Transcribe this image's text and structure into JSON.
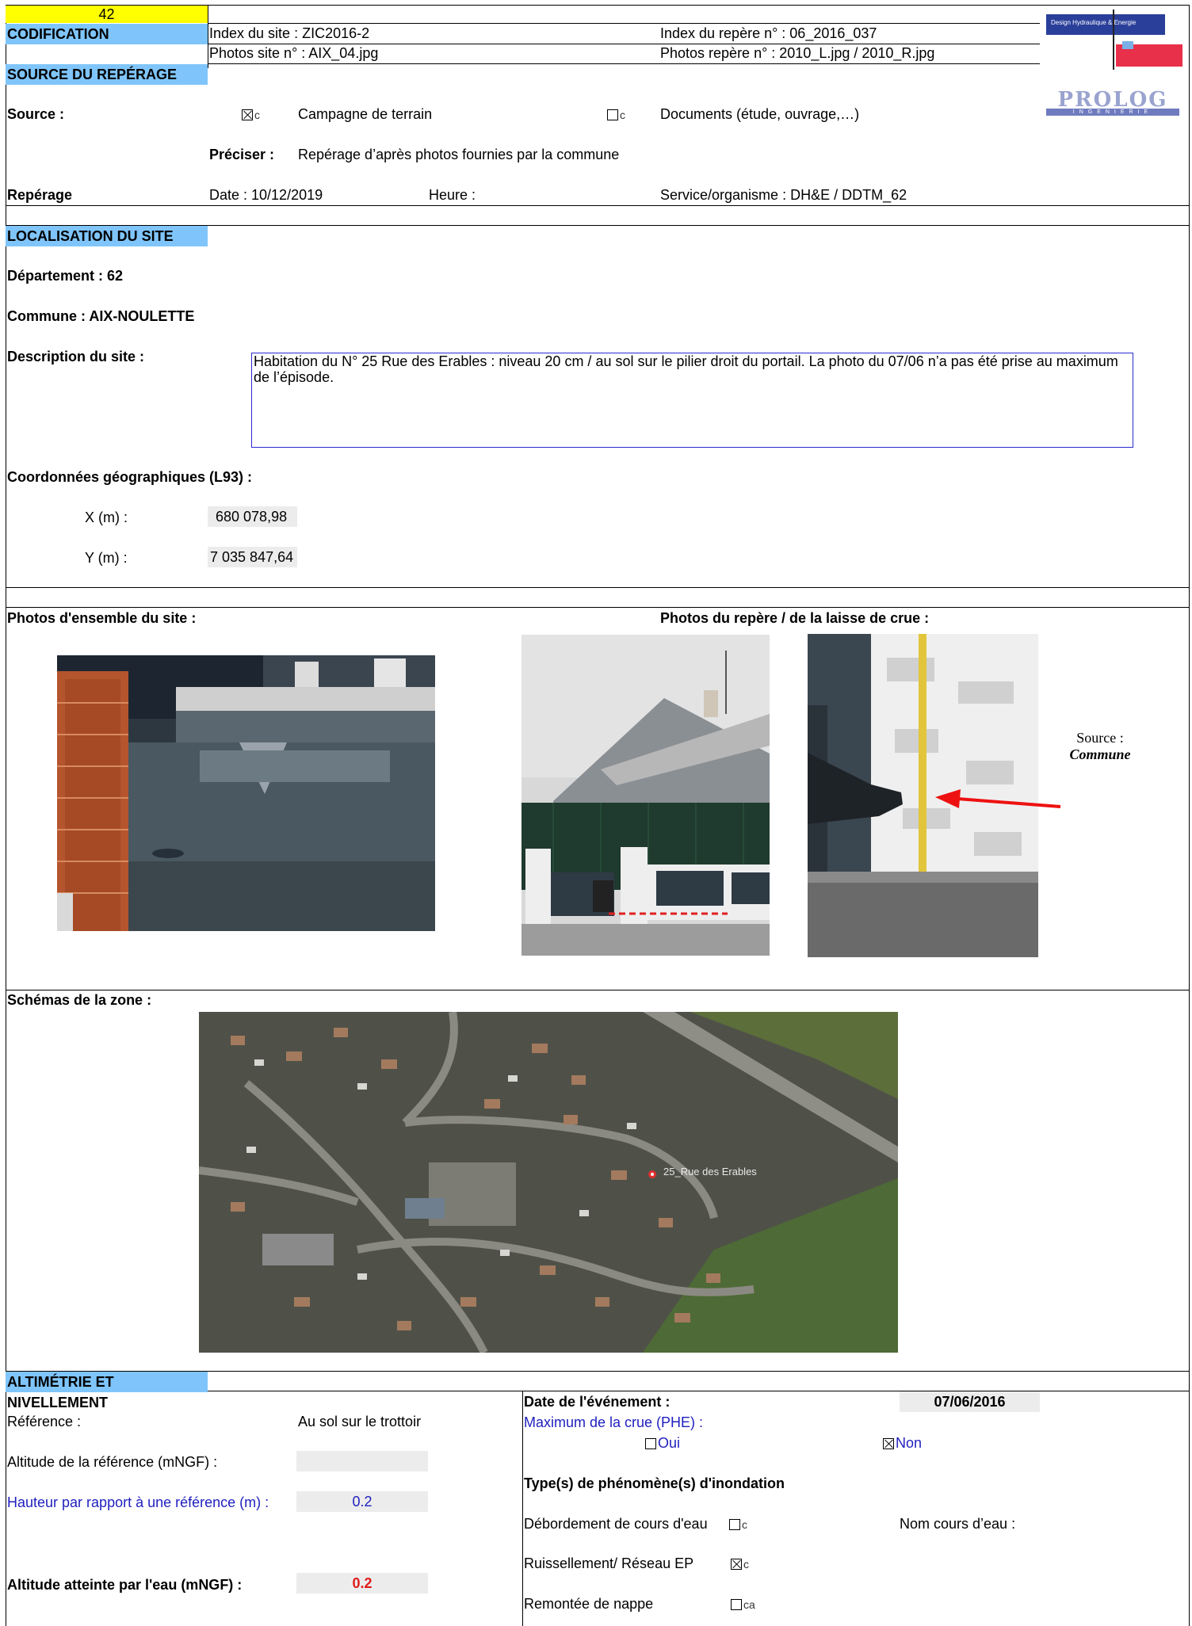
{
  "header": {
    "number": "42",
    "codification_label": "CODIFICATION",
    "index_site": "Index du site : ZIC2016-2",
    "photos_site": "Photos site n° : AIX_04.jpg",
    "index_repere": "Index du repère n° : 06_2016_037",
    "photos_repere": "Photos repère n° : 2010_L.jpg / 2010_R.jpg",
    "logo_top_text": "Design Hydraulique & Energie",
    "logo_bottom_text": "PROLOG",
    "logo_bottom_sub": "INGENIERIE"
  },
  "source": {
    "section_title": "SOURCE DU REPÉRAGE",
    "source_label": "Source :",
    "opt1_mark": "c",
    "opt1_label": "Campagne de terrain",
    "opt2_mark": "c",
    "opt2_label": "Documents (étude, ouvrage,…)",
    "preciser_label": "Préciser :",
    "preciser_value": "Repérage d’après photos fournies par la commune",
    "reperage_label": "Repérage",
    "date": "Date : 10/12/2019",
    "heure": "Heure :",
    "service": "Service/organisme :  DH&E / DDTM_62"
  },
  "localisation": {
    "section_title": "LOCALISATION DU SITE",
    "departement": "Département :  62",
    "commune": "Commune :  AIX-NOULETTE",
    "description_label": "Description du site :",
    "description_text": "Habitation du N° 25 Rue des Erables :  niveau 20 cm / au sol sur le pilier droit du portail. La photo du 07/06 n’a pas été prise au maximum de l’épisode.",
    "coords_label": "Coordonnées géographiques (L93) :",
    "x_label": "X (m) :",
    "x_value": "680 078,98",
    "y_label": "Y (m) :",
    "y_value": "7 035 847,64"
  },
  "photos": {
    "ensemble_label": "Photos d'ensemble du site :",
    "repere_label": "Photos du repère / de la laisse de crue  :",
    "source_label": "Source :",
    "source_value": "Commune"
  },
  "schemas": {
    "label": "Schémas de la zone :",
    "map_label": "25_Rue des Erables"
  },
  "altimetrie": {
    "section_title": "ALTIMÉTRIE ET NIVELLEMENT",
    "reference_label": "Référence :",
    "reference_value": "Au sol sur le trottoir",
    "altitude_ref_label": "Altitude de la référence (mNGF)  :",
    "altitude_ref_value": "",
    "hauteur_label": "Hauteur par rapport à une référence (m) :",
    "hauteur_value": "0.2",
    "altitude_eau_label": "Altitude atteinte par l'eau (mNGF) :",
    "altitude_eau_value": "0.2"
  },
  "evenement": {
    "date_label": "Date de l'événement :",
    "date_value": "07/06/2016",
    "phe_label": "Maximum de la crue (PHE) :",
    "oui": "Oui",
    "non": "Non",
    "type_label": "Type(s) de phénomène(s) d'inondation",
    "debordement": "Débordement de cours d'eau",
    "debordement_mark": "c",
    "nom_cours": "Nom cours d’eau :",
    "ruissellement": "Ruissellement/ Réseau EP",
    "ruissellement_mark": "c",
    "remontee": "Remontée de nappe",
    "remontee_mark": "ca"
  }
}
